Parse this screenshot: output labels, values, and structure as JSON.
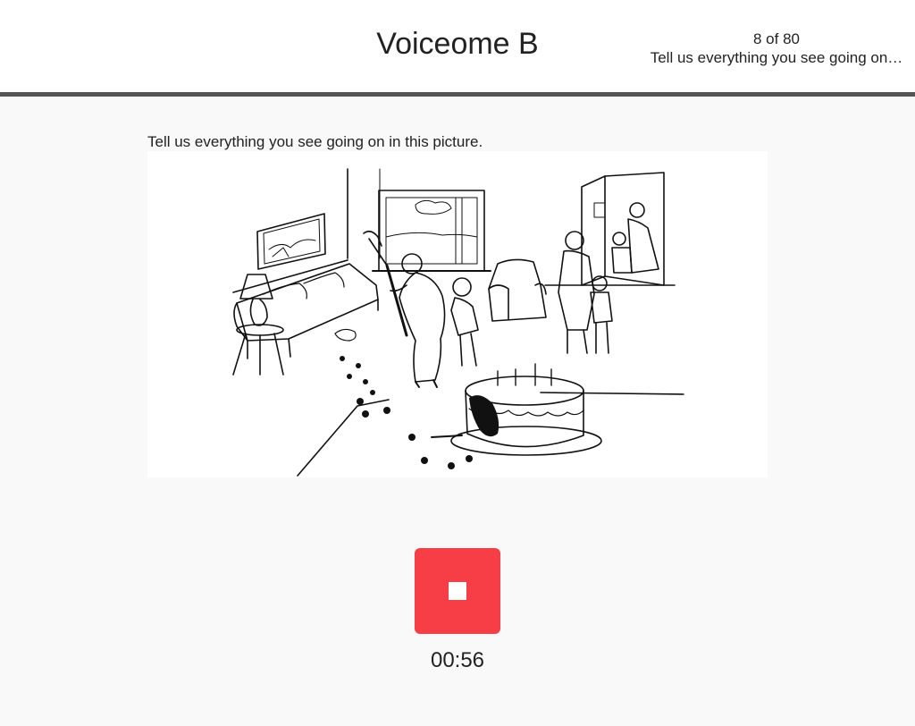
{
  "header": {
    "title": "Voiceome B",
    "progress": "8 of 80",
    "progress_subtitle": "Tell us everything you see going on…"
  },
  "prompt": {
    "text": "Tell us everything you see going on in this picture."
  },
  "recorder": {
    "stop_icon": "stop-square-icon",
    "timer": "00:56",
    "button_color": "#f73d45"
  },
  "theme": {
    "header_border": "#555555",
    "background": "#f9f9f9"
  }
}
